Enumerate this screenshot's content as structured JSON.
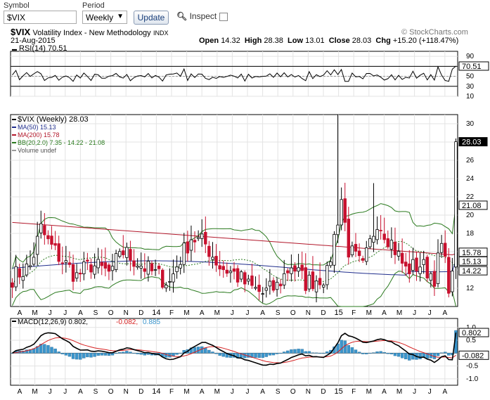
{
  "toolbar": {
    "symbol_label": "Symbol",
    "symbol_value": "$VIX",
    "period_label": "Period",
    "period_value": "Weekly",
    "update_label": "Update",
    "inspect_label": "Inspect"
  },
  "header": {
    "ticker": "$VIX",
    "name": "Volatility Index - New Methodology",
    "exchange": "INDX",
    "date": "21-Aug-2015",
    "open_label": "Open",
    "open": "14.32",
    "high_label": "High",
    "high": "28.38",
    "low_label": "Low",
    "low": "13.01",
    "close_label": "Close",
    "close": "28.03",
    "chg_label": "Chg",
    "chg": "+15.20 (+118.47%)",
    "copyright": "© StockCharts.com"
  },
  "colors": {
    "candle_up": "#ffffff",
    "candle_down": "#c8102e",
    "ma50": "#1f2d8c",
    "ma200": "#b2182b",
    "bb": "#2a7a1e",
    "macd_line": "#000000",
    "macd_signal": "#d62020",
    "macd_hist": "#3b95cc",
    "price_tag": "#000000"
  },
  "chart_data": [
    {
      "type": "line",
      "panel": "rsi",
      "title": "RSI(14) 70.51",
      "series": [
        {
          "name": "RSI(14)",
          "last": 70.51
        }
      ],
      "ylim": [
        10,
        100
      ],
      "yticks": [
        10,
        30,
        50,
        70,
        90
      ],
      "reference_lines": [
        30,
        50,
        70
      ],
      "last_value_tag": "70.51"
    },
    {
      "type": "candlestick",
      "panel": "price",
      "title": "$VIX (Weekly) 28.03",
      "legend": [
        "MA(50) 15.13",
        "MA(200) 15.78",
        "BB(20,2.0) 7.35 - 14.22 - 21.08",
        "Volume undef"
      ],
      "ylim": [
        10,
        31
      ],
      "yticks": [
        12,
        14,
        16,
        18,
        20,
        22,
        24,
        26,
        28,
        30
      ],
      "x_labels": [
        "A",
        "M",
        "J",
        "J",
        "A",
        "S",
        "O",
        "N",
        "D",
        "14",
        "F",
        "M",
        "A",
        "M",
        "J",
        "J",
        "A",
        "S",
        "O",
        "N",
        "D",
        "15",
        "F",
        "M",
        "A",
        "M",
        "J",
        "J",
        "A"
      ],
      "weeks": 125,
      "last_close": 28.03,
      "value_tags": [
        {
          "text": "28.03",
          "value": 28.03,
          "style": "dark"
        },
        {
          "text": "21.08",
          "value": 21.08,
          "style": "light"
        },
        {
          "text": "15.78",
          "value": 15.78,
          "style": "light"
        },
        {
          "text": "15.13",
          "value": 15.13,
          "style": "light"
        },
        {
          "text": "14.22",
          "value": 14.22,
          "style": "light"
        }
      ]
    },
    {
      "type": "line+histogram",
      "panel": "macd",
      "title_prefix": "MACD(12,26,9)",
      "macd": "0.802",
      "signal": "-0.082",
      "hist": "0.885",
      "ylim": [
        -1.25,
        1.35
      ],
      "yticks": [
        -1.0,
        -0.5,
        0.5,
        1.0
      ],
      "ytick_labels": [
        "-1.0",
        "-0.5",
        "0.5",
        "1.0"
      ],
      "x_labels": [
        "A",
        "M",
        "J",
        "J",
        "A",
        "S",
        "O",
        "N",
        "D",
        "14",
        "F",
        "M",
        "A",
        "M",
        "J",
        "J",
        "A",
        "S",
        "O",
        "N",
        "D",
        "15",
        "F",
        "M",
        "A",
        "M",
        "J",
        "J",
        "A"
      ],
      "value_tags": [
        {
          "text": "0.802",
          "value": 0.802
        },
        {
          "text": "-0.082",
          "value": -0.082
        }
      ]
    }
  ]
}
